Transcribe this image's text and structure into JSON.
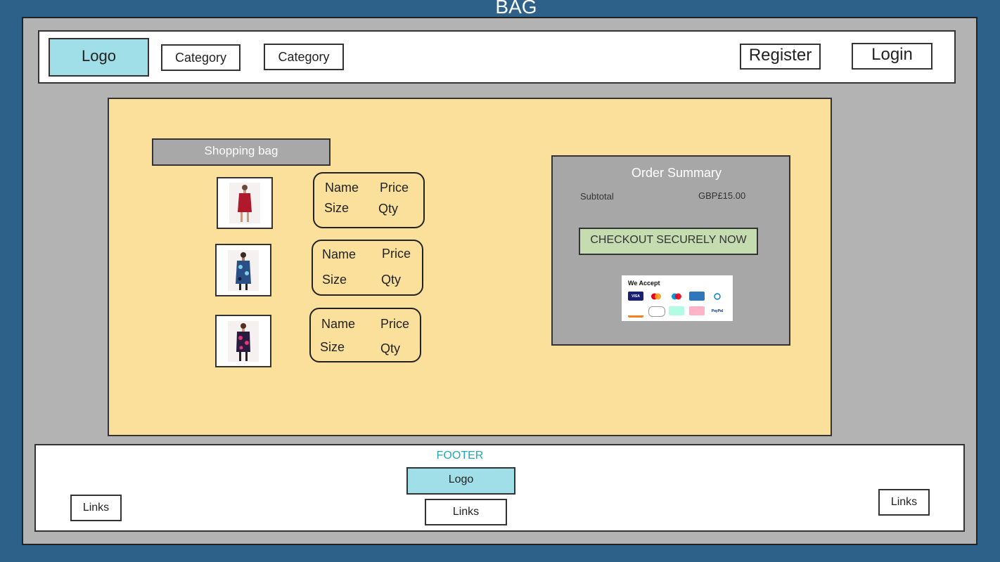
{
  "page": {
    "title": "BAG"
  },
  "header": {
    "logo_label": "Logo",
    "categories": [
      "Category",
      "Category"
    ],
    "register_label": "Register",
    "login_label": "Login"
  },
  "bag": {
    "title": "Shopping bag",
    "items": [
      {
        "name_label": "Name",
        "price_label": "Price",
        "size_label": "Size",
        "qty_label": "Qty",
        "dress_color": "#b0192c"
      },
      {
        "name_label": "Name",
        "price_label": "Price",
        "size_label": "Size",
        "qty_label": "Qty",
        "dress_color": "#2a4f86"
      },
      {
        "name_label": "Name",
        "price_label": "Price",
        "size_label": "Size",
        "qty_label": "Qty",
        "dress_color": "#2a1a3d"
      }
    ]
  },
  "summary": {
    "title": "Order Summary",
    "subtotal_label": "Subtotal",
    "subtotal_value": "GBP£15.00",
    "checkout_label": "CHECKOUT SECURELY NOW",
    "accept_title": "We Accept",
    "cards": [
      {
        "name": "VISA",
        "bg": "#1a1f71",
        "fg": "#ffffff"
      },
      {
        "name": "",
        "bg": "#ffffff",
        "fg": "#eb001b"
      },
      {
        "name": "",
        "bg": "#ffffff",
        "fg": "#0099df"
      },
      {
        "name": "",
        "bg": "#2e77bc",
        "fg": "#ffffff"
      },
      {
        "name": "",
        "bg": "#ffffff",
        "fg": "#0079be"
      },
      {
        "name": "",
        "bg": "#ffffff",
        "fg": "#333333"
      },
      {
        "name": "",
        "bg": "#ffffff",
        "fg": "#333333"
      },
      {
        "name": "",
        "bg": "#b2fce4",
        "fg": "#111111"
      },
      {
        "name": "",
        "bg": "#ffb3c7",
        "fg": "#111111"
      },
      {
        "name": "PayPal",
        "bg": "#ffffff",
        "fg": "#003087"
      }
    ]
  },
  "footer": {
    "title": "FOOTER",
    "logo_label": "Logo",
    "links": [
      "Links",
      "Links",
      "Links"
    ]
  }
}
